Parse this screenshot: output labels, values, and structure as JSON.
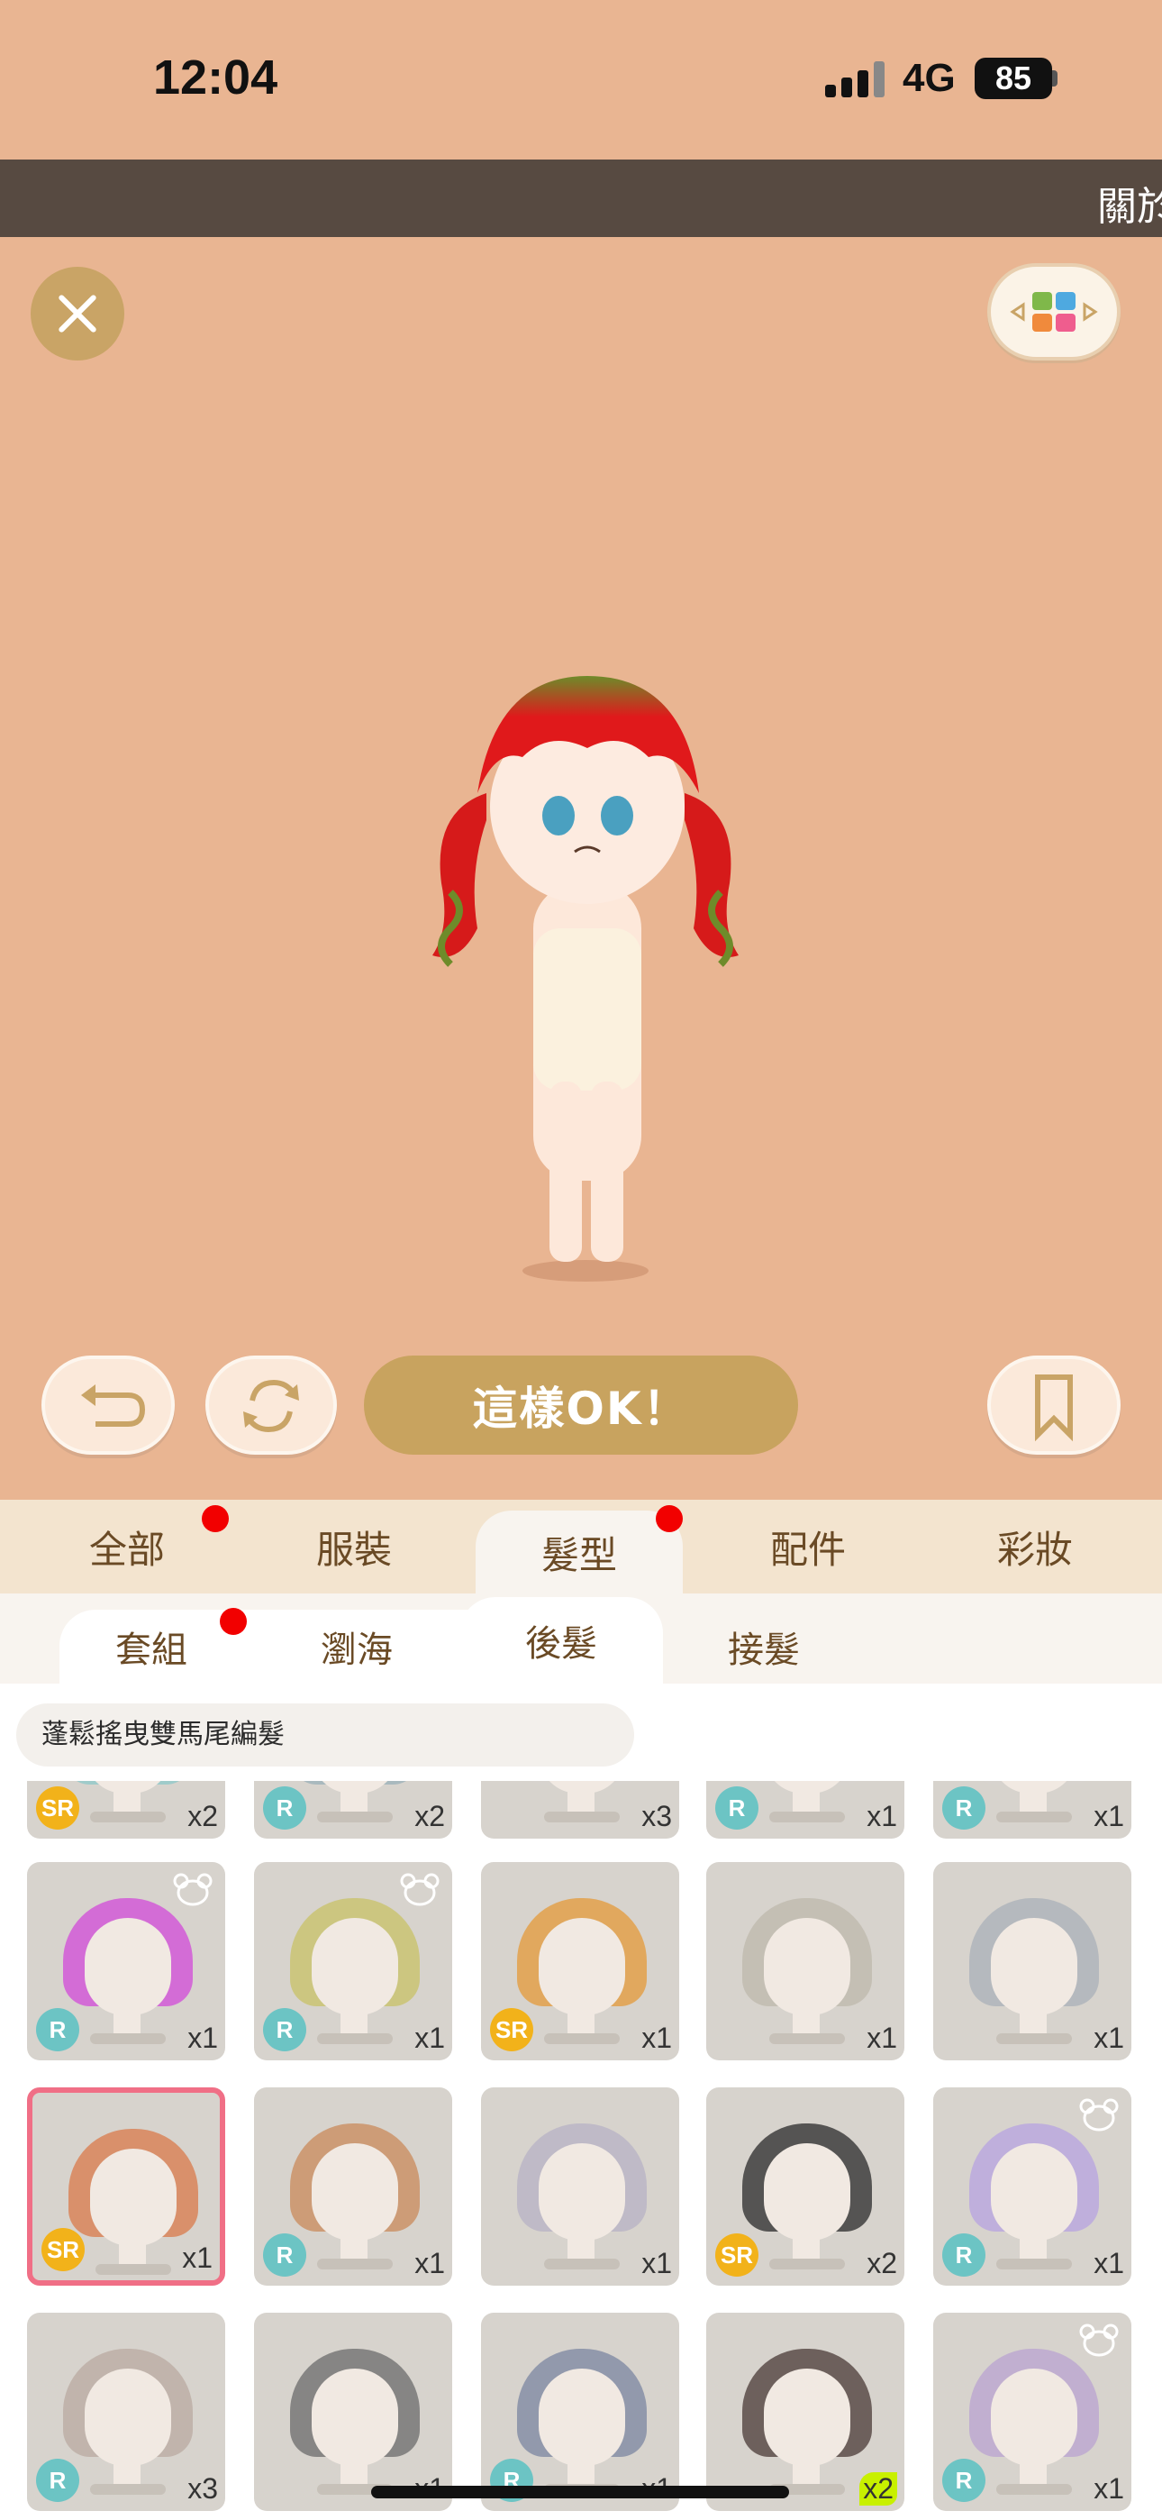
{
  "status": {
    "time": "12:04",
    "network": "4G",
    "battery": "85"
  },
  "banner": {
    "text": "關於"
  },
  "actions": {
    "ok_label": "這樣OK！"
  },
  "main_tabs": [
    {
      "label": "全部",
      "badge": true
    },
    {
      "label": "服裝",
      "badge": false
    },
    {
      "label": "髮型",
      "badge": true,
      "active": true
    },
    {
      "label": "配件",
      "badge": false
    },
    {
      "label": "彩妝",
      "badge": false
    }
  ],
  "sub_tabs": [
    {
      "label": "套組",
      "badge": true
    },
    {
      "label": "瀏海",
      "badge": false
    },
    {
      "label": "後髮",
      "badge": false,
      "active": true
    },
    {
      "label": "接髮",
      "badge": false
    }
  ],
  "selected_item_name": "蓬鬆搖曳雙馬尾編髮",
  "grid_rows": [
    [
      {
        "rarity": "SR",
        "qty": "x2",
        "bear": false,
        "hair": "#8cc8c8"
      },
      {
        "rarity": "R",
        "qty": "x2",
        "bear": false,
        "hair": "#9ab0b8"
      },
      {
        "rarity": "",
        "qty": "x3",
        "bear": false,
        "hair": "#d7d3cd"
      },
      {
        "rarity": "R",
        "qty": "x1",
        "bear": false,
        "hair": "#d7d3cd"
      },
      {
        "rarity": "R",
        "qty": "x1",
        "bear": false,
        "hair": "#d7d3cd"
      }
    ],
    [
      {
        "rarity": "R",
        "qty": "x1",
        "bear": true,
        "hair": "#d24ad8"
      },
      {
        "rarity": "R",
        "qty": "x1",
        "bear": true,
        "hair": "#c8c266"
      },
      {
        "rarity": "SR",
        "qty": "x1",
        "bear": false,
        "hair": "#e49a38"
      },
      {
        "rarity": "",
        "qty": "x1",
        "bear": false,
        "hair": "#bdb8ab"
      },
      {
        "rarity": "",
        "qty": "x1",
        "bear": false,
        "hair": "#a9b0b8"
      }
    ],
    [
      {
        "rarity": "SR",
        "qty": "x1",
        "bear": false,
        "hair": "#d9794a",
        "selected": true
      },
      {
        "rarity": "R",
        "qty": "x1",
        "bear": false,
        "hair": "#c98a5a"
      },
      {
        "rarity": "",
        "qty": "x1",
        "bear": false,
        "hair": "#b7b2c4"
      },
      {
        "rarity": "SR",
        "qty": "x2",
        "bear": false,
        "hair": "#2a2a2a"
      },
      {
        "rarity": "R",
        "qty": "x1",
        "bear": true,
        "hair": "#b7a3e0"
      }
    ],
    [
      {
        "rarity": "R",
        "qty": "x3",
        "bear": false,
        "hair": "#b9aaa0"
      },
      {
        "rarity": "",
        "qty": "x1",
        "bear": false,
        "hair": "#6b6b6b"
      },
      {
        "rarity": "R",
        "qty": "x1",
        "bear": false,
        "hair": "#7b86a0"
      },
      {
        "rarity": "",
        "qty": "x2",
        "bear": false,
        "hair": "#4a3a35",
        "qty_highlight": true
      },
      {
        "rarity": "R",
        "qty": "x1",
        "bear": true,
        "hair": "#b9a3d0"
      }
    ]
  ],
  "colors": {
    "background": "#e9b592",
    "ok_button": "#c8a35f",
    "accent_gold": "#c9a466",
    "badge": "#f20000",
    "selected_border": "#f06f86"
  }
}
